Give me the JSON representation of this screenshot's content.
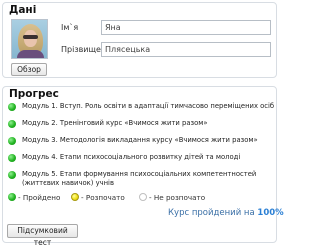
{
  "data_section": {
    "title": "Дані",
    "avatar_icon": "user-photo",
    "browse_label": "Обзор",
    "first_name_label": "Ім`я",
    "first_name_value": "Яна",
    "last_name_label": "Прізвище",
    "last_name_value": "Плясецька"
  },
  "progress_section": {
    "title": "Прогрес",
    "modules": [
      {
        "text": "Модуль 1. Вступ. Роль освіти в адаптації тимчасово переміщених осіб",
        "status": "completed"
      },
      {
        "text": "Модуль 2. Тренінговий курс «Вчимося жити разом»",
        "status": "completed"
      },
      {
        "text": "Модуль 3. Методологія викладання курсу «Вчимося жити разом»",
        "status": "completed"
      },
      {
        "text": "Модуль 4. Етапи психосоціального розвитку дітей та молоді",
        "status": "completed"
      },
      {
        "text": "Модуль 5. Етапи формування психосоціальних компетентностей (життєвих навичок) учнів",
        "status": "completed"
      }
    ],
    "legend": {
      "completed": "- Пройдено",
      "started": "- Розпочато",
      "not_started": "- Не розпочато"
    },
    "course_status_label": "Курс пройдений на",
    "course_percent": "100%",
    "summary_test_label": "Підсумковий тест"
  },
  "colors": {
    "completed": "#22b422",
    "started": "#f2e21a",
    "not_started": "#ffffff",
    "accent": "#3a6fa6"
  }
}
